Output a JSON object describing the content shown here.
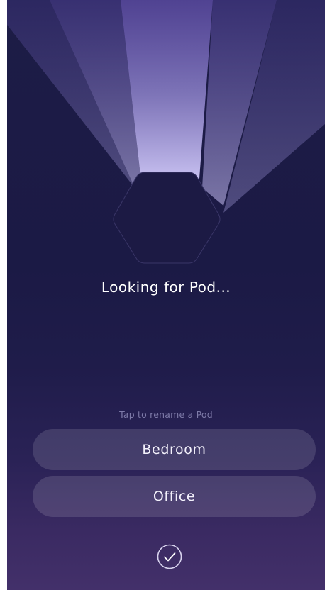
{
  "status": {
    "message": "Looking for Pod..."
  },
  "rename": {
    "hint": "Tap to rename a Pod",
    "pods": [
      {
        "label": "Bedroom"
      },
      {
        "label": "Office"
      }
    ]
  },
  "icons": {
    "device": "hexagon-pod-icon",
    "confirm": "checkmark-circle-icon"
  },
  "colors": {
    "background_top": "#1d1c46",
    "background_bottom": "#43306a",
    "beam": "#b7aef0",
    "hint": "#7d7aa8"
  }
}
